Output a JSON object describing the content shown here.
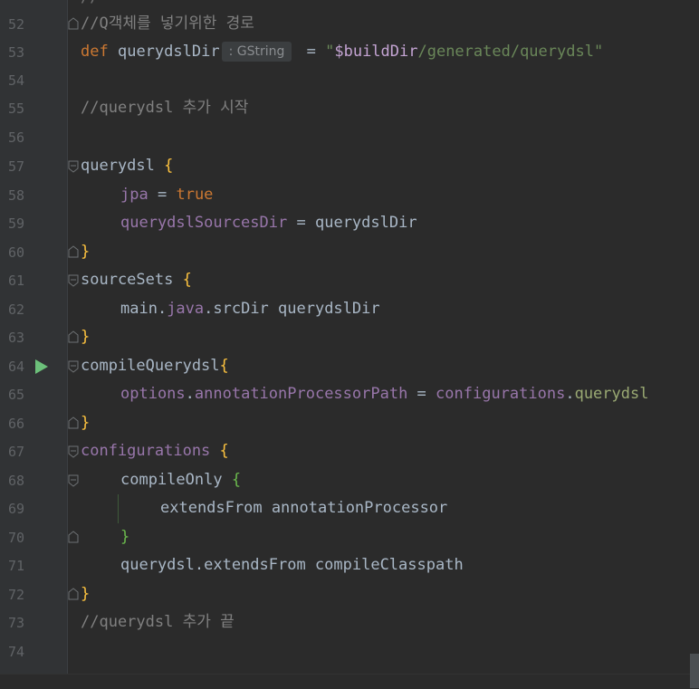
{
  "editor": {
    "lines": [
      {
        "num": "52",
        "text": "//Q객체를 넣기위한 경로"
      },
      {
        "num": "53",
        "kw": "def",
        "name": "querydslDir",
        "hint": ": GString",
        "eq": "=",
        "q1": "\"",
        "var": "$buildDir",
        "path": "/generated/querydsl",
        "q2": "\""
      },
      {
        "num": "54"
      },
      {
        "num": "55",
        "text": "//querydsl 추가 시작"
      },
      {
        "num": "56"
      },
      {
        "num": "57",
        "name": "querydsl",
        "brace": "{"
      },
      {
        "num": "58",
        "prop": "jpa",
        "eq": "=",
        "val": "true"
      },
      {
        "num": "59",
        "prop": "querydslSourcesDir",
        "eq": "=",
        "val": "querydslDir"
      },
      {
        "num": "60",
        "brace": "}"
      },
      {
        "num": "61",
        "name": "sourceSets",
        "brace": "{"
      },
      {
        "num": "62",
        "a": "main.",
        "b": "java",
        "c": ".srcDir querydslDir"
      },
      {
        "num": "63",
        "brace": "}"
      },
      {
        "num": "64",
        "name": "compileQuerydsl",
        "brace": "{"
      },
      {
        "num": "65",
        "a": "options",
        "b": ".",
        "c": "annotationProcessorPath",
        "d": " = ",
        "e": "configurations",
        "f": ".",
        "g": "querydsl"
      },
      {
        "num": "66",
        "brace": "}"
      },
      {
        "num": "67",
        "name": "configurations",
        "brace": "{"
      },
      {
        "num": "68",
        "name": "compileOnly",
        "brace": "{"
      },
      {
        "num": "69",
        "text": "extendsFrom annotationProcessor"
      },
      {
        "num": "70",
        "brace": "}"
      },
      {
        "num": "71",
        "text": "querydsl.extendsFrom compileClasspath"
      },
      {
        "num": "72",
        "brace": "}"
      },
      {
        "num": "73",
        "text": "//querydsl 추가 끝"
      },
      {
        "num": "74"
      }
    ]
  }
}
